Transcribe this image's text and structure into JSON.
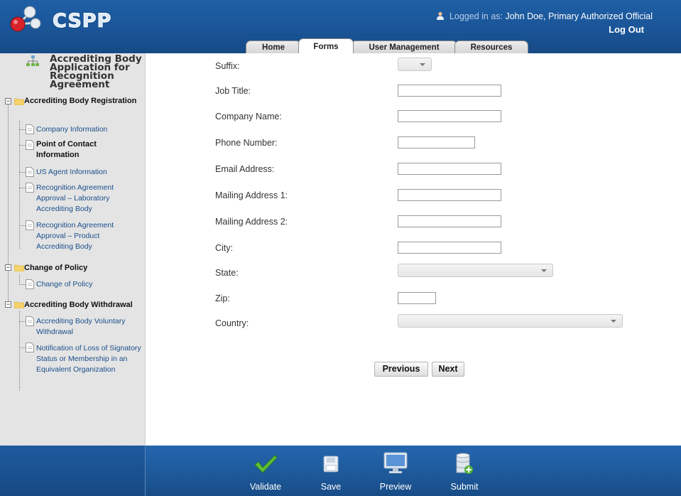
{
  "app": {
    "logo_text": "CSPP",
    "login_prefix": "Logged in as:",
    "login_user": "John Doe, Primary Authorized Official",
    "logout_label": "Log Out"
  },
  "tabs": [
    {
      "label": "Home",
      "active": false
    },
    {
      "label": "Forms",
      "active": true
    },
    {
      "label": "User Management",
      "active": false
    },
    {
      "label": "Resources",
      "active": false
    }
  ],
  "sidebar": {
    "title": "Accrediting Body Application for Recognition Agreement",
    "sections": [
      {
        "label": "Accrediting Body Registration",
        "items": [
          {
            "label": "Company Information",
            "current": false
          },
          {
            "label": "Point of Contact Information",
            "current": true
          },
          {
            "label": "US Agent Information",
            "current": false
          },
          {
            "label": "Recognition Agreement Approval – Laboratory Accrediting Body",
            "current": false
          },
          {
            "label": "Recognition Agreement Approval – Product Accrediting Body",
            "current": false
          }
        ]
      },
      {
        "label": "Change of Policy",
        "items": [
          {
            "label": "Change of Policy",
            "current": false
          }
        ]
      },
      {
        "label": "Accrediting Body Withdrawal",
        "items": [
          {
            "label": "Accrediting Body Voluntary Withdrawal",
            "current": false
          },
          {
            "label": "Notification of Loss of Signatory Status or Membership in an Equivalent Organization",
            "current": false
          }
        ]
      }
    ]
  },
  "form": {
    "fields": [
      {
        "label": "Suffix:",
        "type": "select",
        "value": ""
      },
      {
        "label": "Job Title:",
        "type": "text",
        "value": ""
      },
      {
        "label": "Company Name:",
        "type": "text",
        "value": ""
      },
      {
        "label": "Phone Number:",
        "type": "text",
        "value": ""
      },
      {
        "label": "Email Address:",
        "type": "text",
        "value": ""
      },
      {
        "label": "Mailing Address 1:",
        "type": "text",
        "value": ""
      },
      {
        "label": "Mailing Address 2:",
        "type": "text",
        "value": ""
      },
      {
        "label": "City:",
        "type": "text",
        "value": ""
      },
      {
        "label": "State:",
        "type": "select",
        "value": ""
      },
      {
        "label": "Zip:",
        "type": "text",
        "value": ""
      },
      {
        "label": "Country:",
        "type": "select",
        "value": ""
      }
    ],
    "previous_label": "Previous",
    "next_label": "Next"
  },
  "footer": {
    "actions": [
      {
        "label": "Validate",
        "icon": "checkmark-icon"
      },
      {
        "label": "Save",
        "icon": "floppy-disk-icon"
      },
      {
        "label": "Preview",
        "icon": "monitor-icon"
      },
      {
        "label": "Submit",
        "icon": "database-add-icon"
      }
    ]
  },
  "colors": {
    "header_blue": "#1a5597",
    "footer_blue": "#1d5899",
    "sidebar_bg": "#e4e4e4",
    "link_blue": "#1a4f8c",
    "check_green": "#4caf2a"
  }
}
